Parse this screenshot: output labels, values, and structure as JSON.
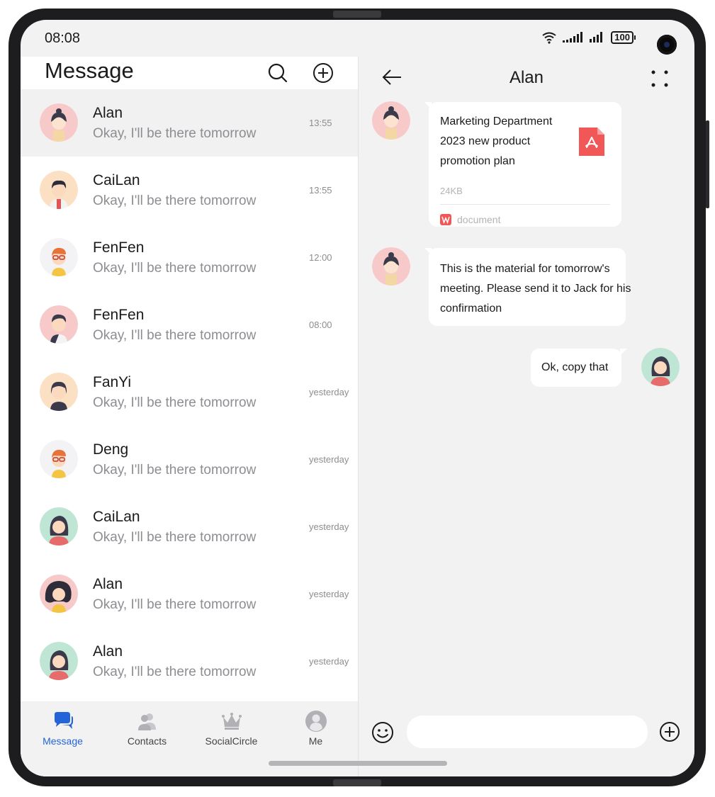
{
  "status": {
    "time": "08:08",
    "battery": "100"
  },
  "left": {
    "title": "Message",
    "conversations": [
      {
        "name": "Alan",
        "message": "Okay, I'll be there tomorrow",
        "time": "13:55",
        "avatar": "girl-bun"
      },
      {
        "name": "CaiLan",
        "message": "Okay, I'll be there tomorrow",
        "time": "13:55",
        "avatar": "boy-dark"
      },
      {
        "name": "FenFen",
        "message": "Okay, I'll be there tomorrow",
        "time": "12:00",
        "avatar": "boy-glasses"
      },
      {
        "name": "FenFen",
        "message": "Okay, I'll be there tomorrow",
        "time": "08:00",
        "avatar": "boy-pink"
      },
      {
        "name": "FanYi",
        "message": "Okay, I'll be there tomorrow",
        "time": "yesterday",
        "avatar": "girl-short"
      },
      {
        "name": "Deng",
        "message": "Okay, I'll be there tomorrow",
        "time": "yesterday",
        "avatar": "boy-glasses"
      },
      {
        "name": "CaiLan",
        "message": "Okay, I'll be there tomorrow",
        "time": "yesterday",
        "avatar": "girl-long"
      },
      {
        "name": "Alan",
        "message": "Okay, I'll be there tomorrow",
        "time": "yesterday",
        "avatar": "girl-curly"
      },
      {
        "name": "Alan",
        "message": "Okay, I'll be there tomorrow",
        "time": "yesterday",
        "avatar": "girl-long"
      }
    ],
    "tabs": [
      {
        "label": "Message",
        "icon": "chat-bubbles-icon"
      },
      {
        "label": "Contacts",
        "icon": "contacts-icon"
      },
      {
        "label": "SocialCircle",
        "icon": "crown-icon"
      },
      {
        "label": "Me",
        "icon": "person-icon"
      }
    ]
  },
  "chat": {
    "title": "Alan",
    "file": {
      "title": "Marketing Department 2023 new product promotion plan",
      "size": "24KB",
      "source": "document"
    },
    "incoming_text": "This is the material for tomorrow's meeting. Please send it to Jack for his confirmation",
    "outgoing_text": "Ok, copy that",
    "colors": {
      "pdf_red": "#f25757",
      "accent_blue": "#2563d9"
    }
  }
}
